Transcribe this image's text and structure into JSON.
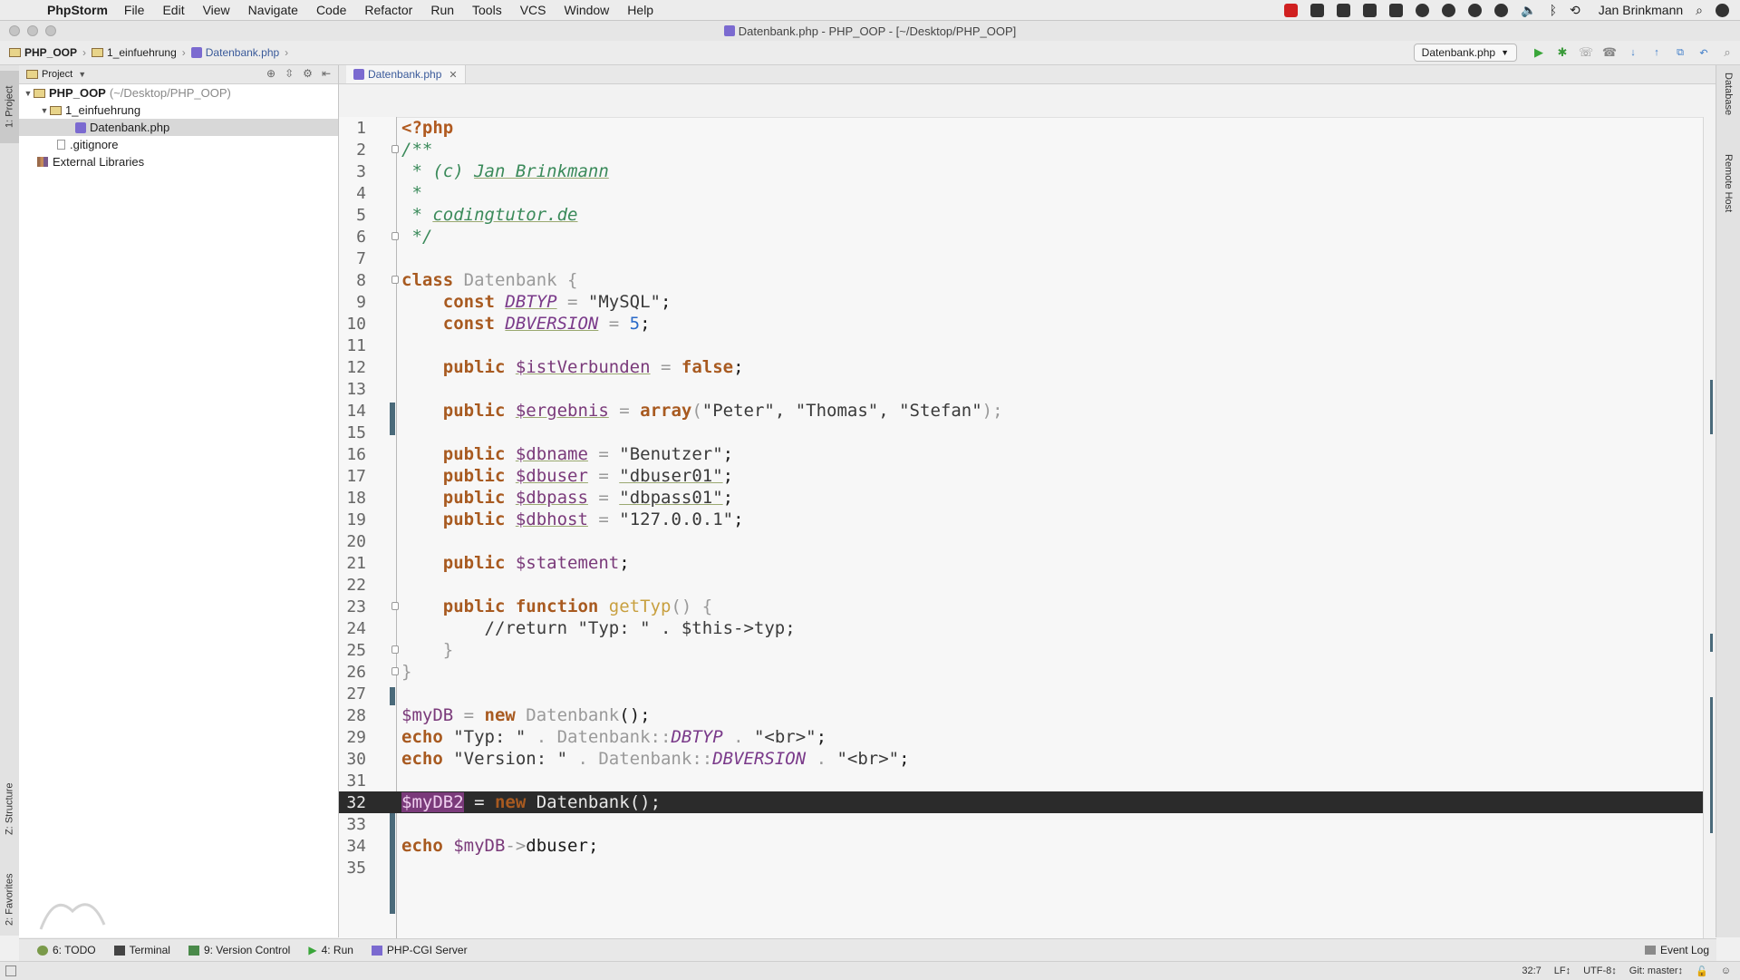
{
  "menubar": {
    "app_name": "PhpStorm",
    "menus": [
      "File",
      "Edit",
      "View",
      "Navigate",
      "Code",
      "Refactor",
      "Run",
      "Tools",
      "VCS",
      "Window",
      "Help"
    ],
    "user": "Jan Brinkmann"
  },
  "window": {
    "title": "Datenbank.php - PHP_OOP - [~/Desktop/PHP_OOP]"
  },
  "navbar": {
    "crumbs": [
      "PHP_OOP",
      "1_einfuehrung",
      "Datenbank.php"
    ],
    "run_config": "Datenbank.php"
  },
  "left_stripe": {
    "project_tab": "1: Project",
    "structure_tab": "Z: Structure",
    "favorites_tab": "2: Favorites"
  },
  "project_panel": {
    "header": "Project",
    "tree": [
      {
        "label": "PHP_OOP",
        "hint": "(~/Desktop/PHP_OOP)"
      },
      {
        "label": "1_einfuehrung"
      },
      {
        "label": "Datenbank.php"
      },
      {
        "label": ".gitignore"
      },
      {
        "label": "External Libraries"
      }
    ]
  },
  "editor": {
    "tab": "Datenbank.php",
    "current_line": 32,
    "lines": [
      {
        "n": "1"
      },
      {
        "n": "2"
      },
      {
        "n": "3"
      },
      {
        "n": "4"
      },
      {
        "n": "5"
      },
      {
        "n": "6"
      },
      {
        "n": "7"
      },
      {
        "n": "8"
      },
      {
        "n": "9"
      },
      {
        "n": "10"
      },
      {
        "n": "11"
      },
      {
        "n": "12"
      },
      {
        "n": "13"
      },
      {
        "n": "14"
      },
      {
        "n": "15"
      },
      {
        "n": "16"
      },
      {
        "n": "17"
      },
      {
        "n": "18"
      },
      {
        "n": "19"
      },
      {
        "n": "20"
      },
      {
        "n": "21"
      },
      {
        "n": "22"
      },
      {
        "n": "23"
      },
      {
        "n": "24"
      },
      {
        "n": "25"
      },
      {
        "n": "26"
      },
      {
        "n": "27"
      },
      {
        "n": "28"
      },
      {
        "n": "29"
      },
      {
        "n": "30"
      },
      {
        "n": "31"
      },
      {
        "n": "32"
      },
      {
        "n": "33"
      },
      {
        "n": "34"
      },
      {
        "n": "35"
      }
    ],
    "code": {
      "l1": "<?php",
      "l2": "/**",
      "l3a": " * (c) ",
      "l3b": "Jan Brinkmann",
      "l4": " *",
      "l5a": " * ",
      "l5b": "codingtutor.de",
      "l6": " */",
      "l8a": "class ",
      "l8b": "Datenbank",
      "l8c": " {",
      "l9a": "    const ",
      "l9b": "DBTYP",
      "l9c": " = ",
      "l9d": "\"MySQL\"",
      "l9e": ";",
      "l10a": "    const ",
      "l10b": "DBVERSION",
      "l10c": " = ",
      "l10d": "5",
      "l10e": ";",
      "l12a": "    public ",
      "l12b": "$istVerbunden",
      "l12c": " = ",
      "l12d": "false",
      "l12e": ";",
      "l14a": "    public ",
      "l14b": "$ergebnis",
      "l14c": " = ",
      "l14d": "array",
      "l14e": "(",
      "l14f": "\"Peter\", \"Thomas\", \"Stefan\"",
      "l14g": ");",
      "l16a": "    public ",
      "l16b": "$dbname",
      "l16c": " = ",
      "l16d": "\"Benutzer\"",
      "l16e": ";",
      "l17a": "    public ",
      "l17b": "$dbuser",
      "l17c": " = ",
      "l17d": "\"dbuser01\"",
      "l17e": ";",
      "l18a": "    public ",
      "l18b": "$dbpass",
      "l18c": " = ",
      "l18d": "\"dbpass01\"",
      "l18e": ";",
      "l19a": "    public ",
      "l19b": "$dbhost",
      "l19c": " = ",
      "l19d": "\"127.0.0.1\"",
      "l19e": ";",
      "l21a": "    public ",
      "l21b": "$statement",
      "l21c": ";",
      "l23a": "    public function ",
      "l23b": "getTyp",
      "l23c": "() {",
      "l24": "        //return \"Typ: \" . $this->typ;",
      "l25": "    }",
      "l26": "}",
      "l28a": "$myDB",
      "l28b": " = ",
      "l28c": "new ",
      "l28d": "Datenbank",
      "l28e": "();",
      "l29a": "echo ",
      "l29b": "\"Typ: \"",
      "l29c": " . Datenbank::",
      "l29d": "DBTYP",
      "l29e": " . ",
      "l29f": "\"<br>\"",
      "l29g": ";",
      "l30a": "echo ",
      "l30b": "\"Version: \"",
      "l30c": " . Datenbank::",
      "l30d": "DBVERSION",
      "l30e": " . ",
      "l30f": "\"<br>\"",
      "l30g": ";",
      "l32a": "$myDB2",
      "l32b": " = ",
      "l32c": "new ",
      "l32d": "Datenbank",
      "l32e": "();",
      "l34a": "echo ",
      "l34b": "$myDB",
      "l34c": "->",
      "l34d": "dbuser",
      "l34e": ";"
    }
  },
  "right_stripe": {
    "database_tab": "Database",
    "remote_tab": "Remote Host"
  },
  "bottom_tools": {
    "todo": "6: TODO",
    "terminal": "Terminal",
    "vcs": "9: Version Control",
    "run": "4: Run",
    "php_cgi": "PHP-CGI Server",
    "event_log": "Event Log"
  },
  "status": {
    "position": "32:7",
    "line_sep": "LF↕",
    "encoding": "UTF-8↕",
    "git": "Git: master↕"
  },
  "colors": {
    "keyword": "#a85a20",
    "variable": "#7a3a7a",
    "comment": "#4a8a5a",
    "current_line": "#2b2b2b"
  }
}
